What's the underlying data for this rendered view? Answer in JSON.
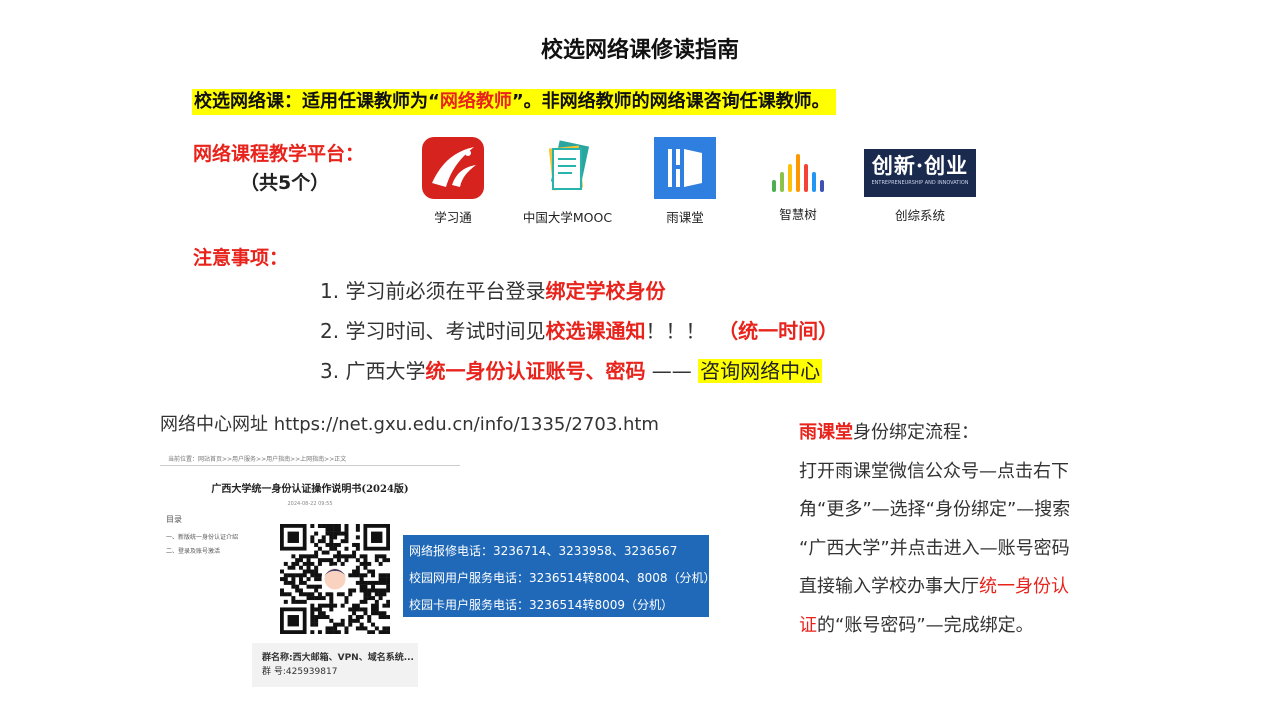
{
  "title": "校选网络课修读指南",
  "banner": {
    "part1": "校选网络课：适用任课教师为“",
    "highlight": "网络教师",
    "part2": "”。非网络教师的网络课咨询任课教师。"
  },
  "platforms": {
    "heading": "网络课程教学平台：",
    "count": "（共5个）",
    "items": [
      {
        "label": "学习通",
        "icon": "xuexitong-logo"
      },
      {
        "label": "中国大学MOOC",
        "icon": "mooc-logo"
      },
      {
        "label": "雨课堂",
        "icon": "yuketang-logo"
      },
      {
        "label": "智慧树",
        "icon": "zhihuishu-logo"
      },
      {
        "label": "创综系统",
        "icon": "chuangzong-logo"
      }
    ],
    "chuangzong_logo_text": "创新·创业",
    "chuangzong_logo_sub": "ENTREPRENEURSHIP AND INNOVATION"
  },
  "notices": {
    "heading": "注意事项：",
    "n1_prefix": "1. 学习前必须在平台登录",
    "n1_red": "绑定学校身份",
    "n2_prefix": "2. 学习时间、考试时间见",
    "n2_red": "校选课通知",
    "n2_mid": "！！！  ",
    "n2_red2": "（统一时间）",
    "n3_prefix": "3. 广西大学",
    "n3_red": "统一身份认证账号、密码",
    "n3_dash": " —— ",
    "n3_hl": "咨询网络中心"
  },
  "network_center": {
    "label": "网络中心网址",
    "url": "https://net.gxu.edu.cn/info/1335/2703.htm"
  },
  "document": {
    "breadcrumb": "当前位置：网站首页>>用户服务>>用户指南>>上网指南>>正文",
    "title": "广西大学统一身份认证操作说明书(2024版)",
    "date": "2024-08-22 09:55",
    "toc_heading": "目录",
    "toc_item1": "一、新版统一身份认证介绍",
    "toc_item2": "二、登录及账号激活"
  },
  "contacts": {
    "repair": "网络报修电话：3236714、3233958、3236567",
    "campus_net": "校园网用户服务电话：3236514转8004、8008（分机）",
    "campus_card": "校园卡用户服务电话：3236514转8009（分机）"
  },
  "qq_group": {
    "name": "群名称:西大邮箱、VPN、域名系统...",
    "number": "群   号:425939817"
  },
  "process": {
    "l1_red": "雨课堂",
    "l1_rest": "身份绑定流程：",
    "l2": "打开雨课堂微信公众号—点击右下",
    "l3": "角“更多”—选择“身份绑定”—搜索",
    "l4": "“广西大学”并点击进入—账号密码",
    "l5_prefix": "直接输入学校办事大厅",
    "l5_red": "统一身份认",
    "l6_red": "证",
    "l6_rest": "的“账号密码”—完成绑定。"
  }
}
